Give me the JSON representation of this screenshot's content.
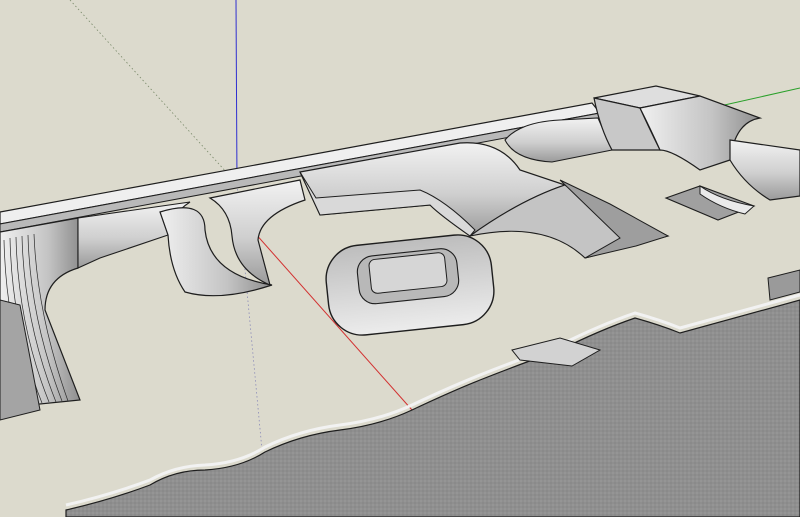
{
  "colors": {
    "ground": "#dcdacd",
    "surface_light": "#e7e7e7",
    "surface_mid": "#c9c9c9",
    "surface_dark": "#9c9c9c",
    "edge": "#1e1e1e",
    "axis_red": "#d23030",
    "axis_green": "#2aa02a",
    "axis_blue": "#2f2fd0"
  },
  "viewport": {
    "kind": "3d-modeling-viewport",
    "model": "skatepark-ramps"
  }
}
